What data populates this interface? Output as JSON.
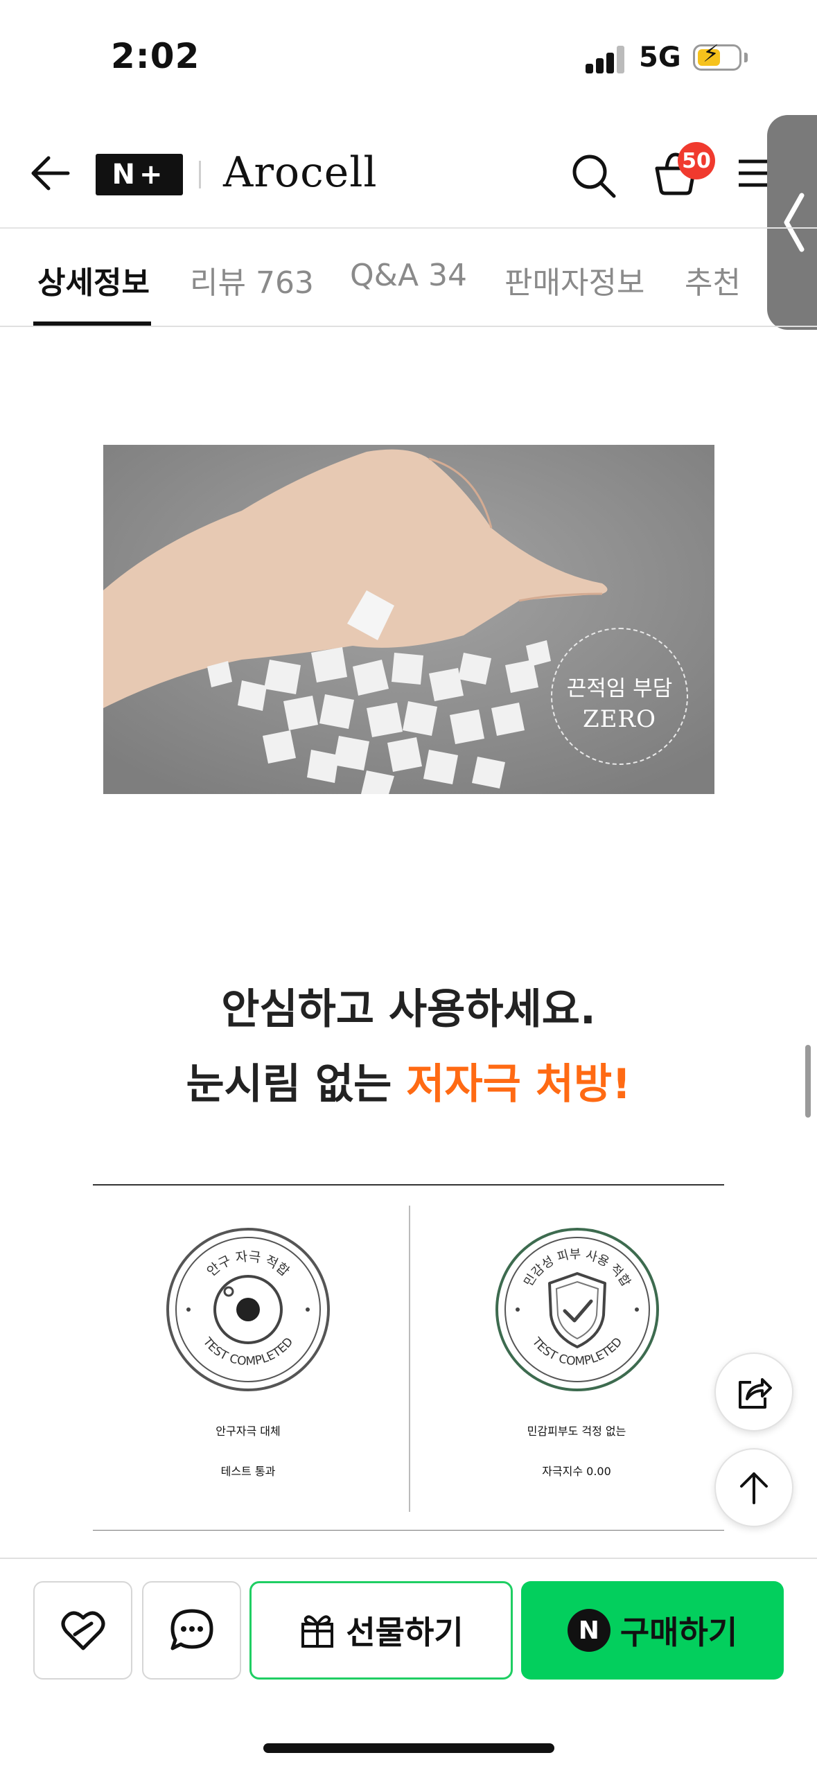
{
  "status_bar": {
    "time": "2:02",
    "network": "5G"
  },
  "header": {
    "logo_mark": "N+",
    "brand": "Arocell",
    "cart_count": "50"
  },
  "tabs": [
    {
      "label": "상세정보",
      "active": true
    },
    {
      "label": "리뷰 763",
      "active": false
    },
    {
      "label": "Q&A 34",
      "active": false
    },
    {
      "label": "판매자정보",
      "active": false
    },
    {
      "label": "추천",
      "active": false
    }
  ],
  "hero": {
    "badge_line1": "끈적임 부담",
    "badge_line2": "ZERO"
  },
  "headline": {
    "line1": "안심하고 사용하세요.",
    "line2_prefix": "눈시림 없는 ",
    "line2_accent": "저자극 처방!",
    "accent_color": "#ff6a13"
  },
  "certs": [
    {
      "seal_top": "안구 자극 적합",
      "seal_bottom": "TEST COMPLETED",
      "caption_line1": "안구자극 대체",
      "caption_line2": "테스트 통과",
      "icon": "eye-icon"
    },
    {
      "seal_top": "민감성 피부 사용 적합",
      "seal_bottom": "TEST COMPLETED",
      "caption_line1": "민감피부도 걱정 없는",
      "caption_line2": "자극지수 0.00",
      "icon": "shield-check-icon"
    }
  ],
  "bottom_bar": {
    "gift_label": "선물하기",
    "buy_label": "구매하기",
    "npay_mark": "N",
    "buy_color": "#03cf5d"
  }
}
